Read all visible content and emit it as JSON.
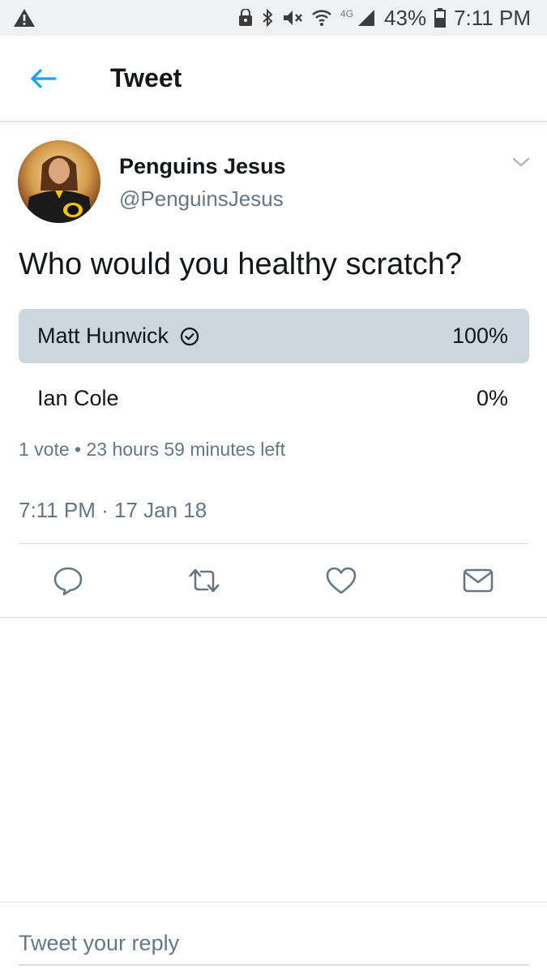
{
  "status_bar": {
    "network": "4G",
    "battery": "43%",
    "time": "7:11 PM"
  },
  "header": {
    "back_icon": "arrow-left-icon",
    "title": "Tweet"
  },
  "tweet": {
    "author_name": "Penguins Jesus",
    "author_handle": "@PenguinsJesus",
    "text": "Who would you healthy scratch?",
    "poll": {
      "options": [
        {
          "label": "Matt Hunwick",
          "percent": "100%",
          "selected": true
        },
        {
          "label": "Ian Cole",
          "percent": "0%",
          "selected": false
        }
      ],
      "meta": "1 vote • 23 hours 59 minutes left"
    },
    "timestamp": "7:11 PM · 17 Jan 18",
    "actions": [
      "reply-icon",
      "retweet-icon",
      "heart-icon",
      "mail-icon"
    ]
  },
  "reply": {
    "placeholder": "Tweet your reply"
  },
  "colors": {
    "accent": "#1da1f2",
    "poll_selected": "#ccd6dd",
    "secondary_text": "#657786"
  }
}
